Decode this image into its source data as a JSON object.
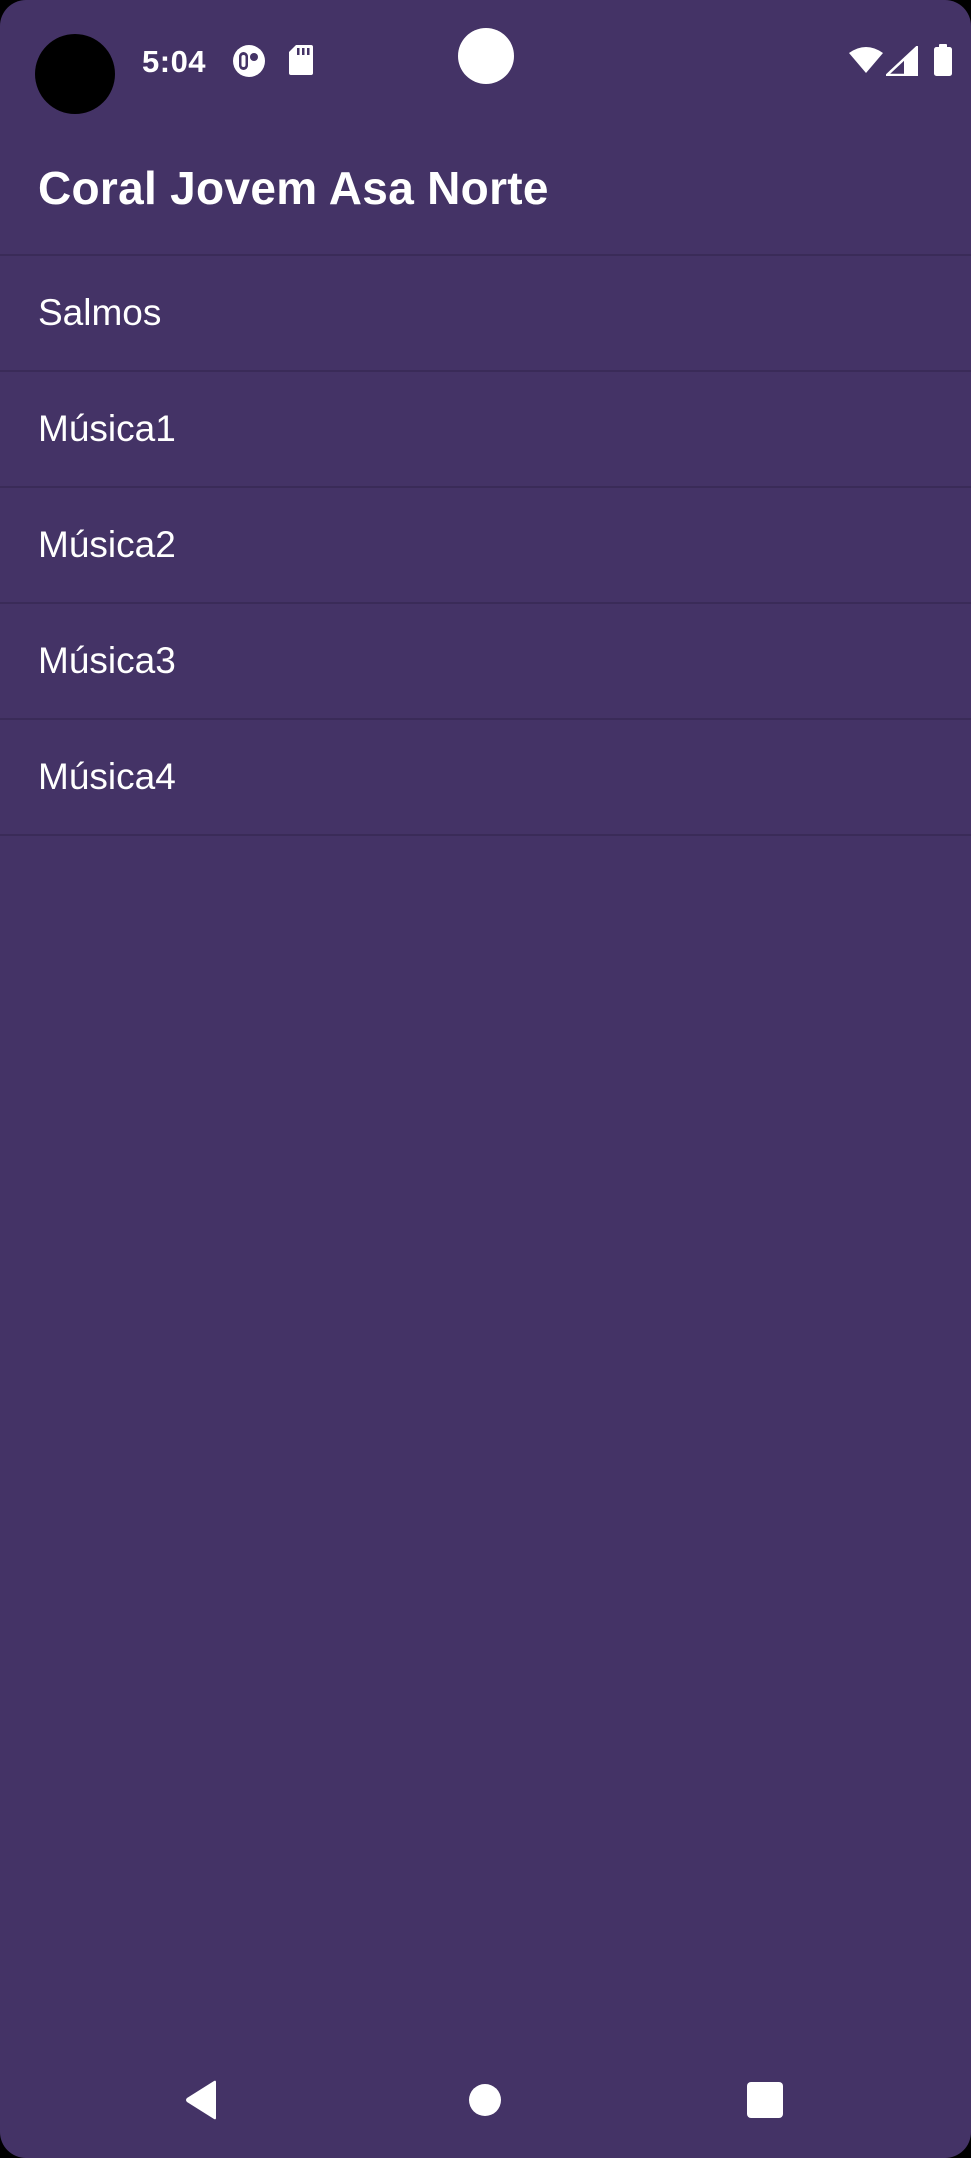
{
  "status_bar": {
    "time": "5:04",
    "icons": [
      "record-icon",
      "sd-card-icon",
      "wifi-icon",
      "signal-icon",
      "battery-icon"
    ]
  },
  "app_bar": {
    "title": "Coral Jovem Asa Norte"
  },
  "list": {
    "items": [
      {
        "label": "Salmos"
      },
      {
        "label": "Música1"
      },
      {
        "label": "Música2"
      },
      {
        "label": "Música3"
      },
      {
        "label": "Música4"
      }
    ]
  },
  "nav_bar": {
    "buttons": [
      "back-icon",
      "home-icon",
      "recents-icon"
    ]
  },
  "colors": {
    "background": "#443366",
    "divider": "#3a2b58",
    "text": "#ffffff"
  }
}
